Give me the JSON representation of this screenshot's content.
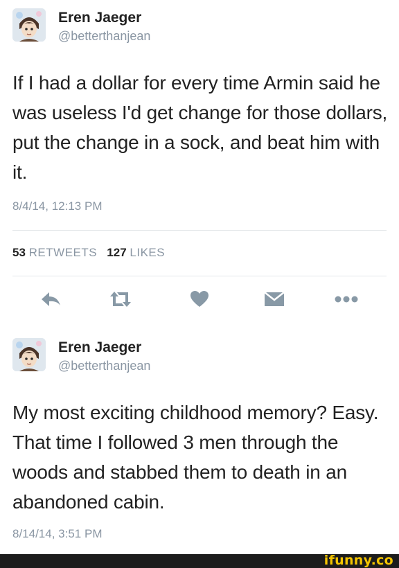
{
  "tweets": [
    {
      "author_name": "Eren Jaeger",
      "handle": "@betterthanjean",
      "text": "If I had a dollar for every time Armin said he was useless I'd get change for those dollars, put the change in a sock, and beat him with it.",
      "timestamp": "8/4/14, 12:13 PM",
      "retweets_count": "53",
      "retweets_label": "RETWEETS",
      "likes_count": "127",
      "likes_label": "LIKES",
      "actions": [
        "reply-icon",
        "retweet-icon",
        "like-icon",
        "dm-icon",
        "more-icon"
      ]
    },
    {
      "author_name": "Eren Jaeger",
      "handle": "@betterthanjean",
      "text": "My most exciting childhood memory? Easy. That time I followed 3 men through the woods and stabbed them to death in an abandoned cabin.",
      "timestamp": "8/14/14, 3:51 PM"
    }
  ],
  "colors": {
    "icon_gray": "#8899a6",
    "text": "#222222",
    "muted": "#8a96a3",
    "footer_bg": "#1c1c1c",
    "ifunny_yellow": "#f4c400"
  },
  "watermark": "ifunny.co"
}
